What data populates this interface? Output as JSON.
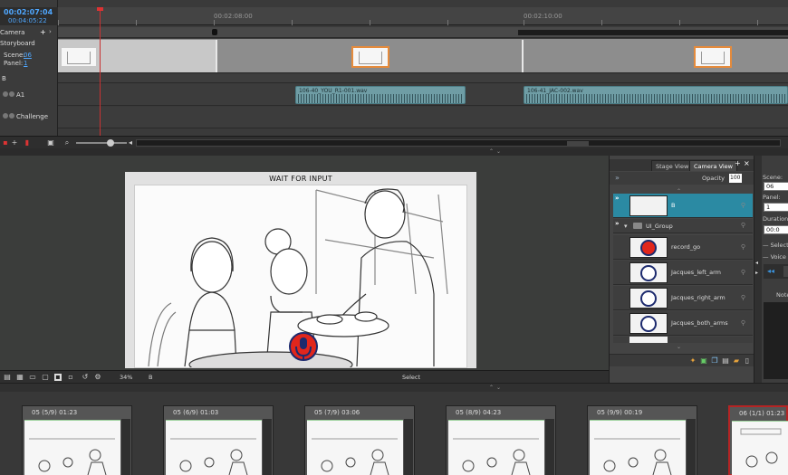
{
  "timecode": {
    "main": "00:02:07:04",
    "sub": "00:04:05:22"
  },
  "ruler": {
    "marks": [
      "00:02:08:00",
      "00:02:10:00"
    ]
  },
  "tracks": {
    "camera": "Camera",
    "storyboard": "Storyboard",
    "scene_label": "Scene:",
    "scene_value": "06",
    "panel_label": "Panel:",
    "panel_value": "1",
    "b_track": "B",
    "a1": "A1",
    "challenge": "Challenge"
  },
  "audio_clips": [
    "106-40_YOU_R1-001.wav",
    "106-41_JAC-002.wav"
  ],
  "stage": {
    "caption": "WAIT FOR INPUT",
    "zoom": "34%",
    "layer_field": "B",
    "tool_hint": "Select"
  },
  "layers_panel": {
    "tabs": [
      "Stage View",
      "Camera View"
    ],
    "active_tab": "Camera View",
    "opacity_label": "Opacity",
    "opacity_value": "100",
    "layers": [
      {
        "name": "B",
        "selected": true
      },
      {
        "name": "UI_Group",
        "group": true
      },
      {
        "name": "record_go"
      },
      {
        "name": "Jacques_left_arm"
      },
      {
        "name": "Jacques_right_arm"
      },
      {
        "name": "Jacques_both_arms"
      }
    ]
  },
  "properties": {
    "scene_label": "Scene:",
    "scene_value": "06",
    "panel_label": "Panel:",
    "panel_value": "1",
    "duration_label": "Duration:",
    "duration_value": "00:0",
    "select_label": "— Select",
    "voice_label": "— Voice A",
    "notes_label": "Note"
  },
  "thumbnails": [
    {
      "title": "05 (5/9) 01:23"
    },
    {
      "title": "05 (6/9) 01:03"
    },
    {
      "title": "05 (7/9) 03:06"
    },
    {
      "title": "05 (8/9) 04:23"
    },
    {
      "title": "05 (9/9) 00:19"
    },
    {
      "title": "06 (1/1) 01:23"
    }
  ],
  "colors": {
    "accent": "#2b8aa3",
    "timecode": "#4fa7ff",
    "playhead": "#c83232",
    "mic_red": "#e1261c",
    "mic_blue": "#1c2a6e",
    "audio_clip": "#6f9da5"
  }
}
